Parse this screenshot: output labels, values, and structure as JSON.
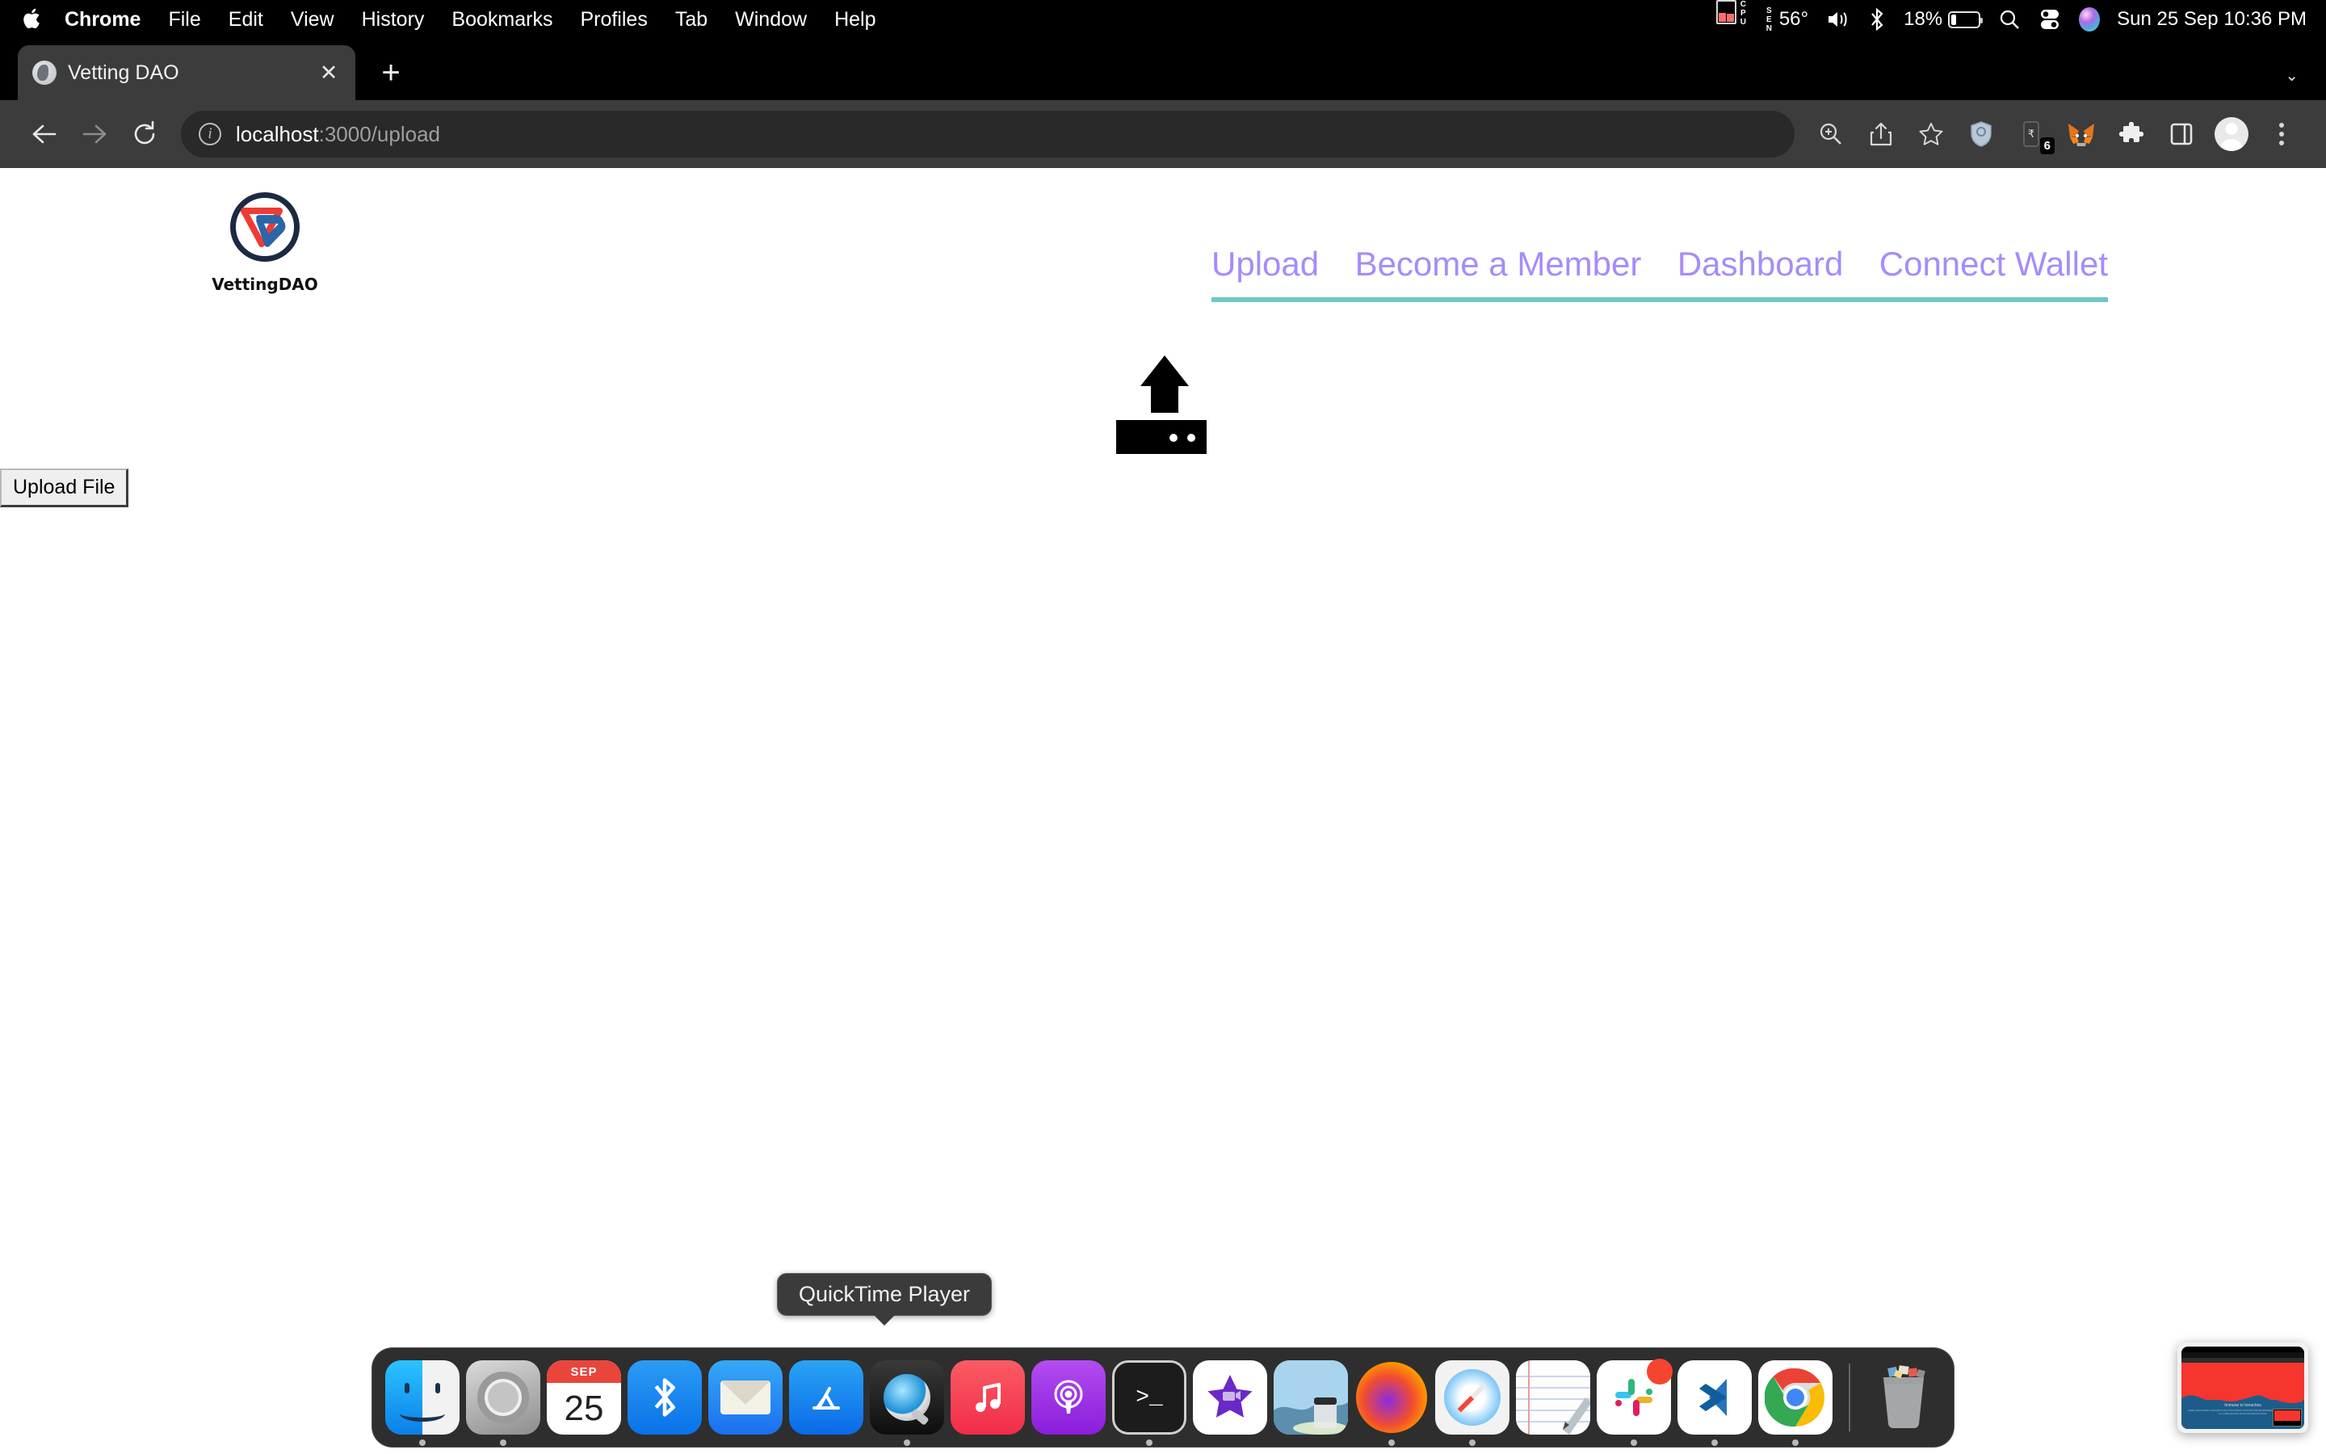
{
  "menubar": {
    "apple_icon": "apple-logo-icon",
    "items": [
      {
        "label": "Chrome",
        "bold": true
      },
      {
        "label": "File",
        "bold": false
      },
      {
        "label": "Edit",
        "bold": false
      },
      {
        "label": "View",
        "bold": false
      },
      {
        "label": "History",
        "bold": false
      },
      {
        "label": "Bookmarks",
        "bold": false
      },
      {
        "label": "Profiles",
        "bold": false
      },
      {
        "label": "Tab",
        "bold": false
      },
      {
        "label": "Window",
        "bold": false
      },
      {
        "label": "Help",
        "bold": false
      }
    ],
    "status": {
      "cpu_label": "CPU",
      "sensor_label": "SEN",
      "temperature": "56°",
      "volume_icon": "speaker-icon",
      "bluetooth_icon": "bluetooth-icon",
      "battery_percent": "18%",
      "battery_level": 18,
      "search_icon": "spotlight-search-icon",
      "control_center_icon": "control-center-icon",
      "siri_icon": "siri-icon",
      "clock": "Sun 25 Sep  10:36 PM"
    }
  },
  "browser": {
    "tab": {
      "title": "Vetting DAO",
      "favicon": "globe-favicon",
      "close_label": "✕"
    },
    "new_tab_label": "+",
    "tabstrip_chevron": "⌄",
    "toolbar": {
      "back_label": "←",
      "forward_label": "→",
      "reload_label": "⟳",
      "url_host": "localhost",
      "url_path": ":3000/upload",
      "site_info_label": "i",
      "icons": [
        {
          "name": "zoom-icon"
        },
        {
          "name": "share-icon"
        },
        {
          "name": "bookmark-star-icon"
        },
        {
          "name": "shield-extension-icon"
        },
        {
          "name": "wallet-extension-icon",
          "badge": "6"
        },
        {
          "name": "metamask-extension-icon"
        },
        {
          "name": "extensions-puzzle-icon"
        },
        {
          "name": "side-panel-icon"
        },
        {
          "name": "profile-avatar-icon"
        },
        {
          "name": "chrome-menu-icon"
        }
      ]
    }
  },
  "page": {
    "brand": {
      "logo_icon": "vettingdao-logo-icon",
      "name": "VettingDAO"
    },
    "nav": {
      "links": [
        {
          "label": "Upload"
        },
        {
          "label": "Become a Member"
        },
        {
          "label": "Dashboard"
        },
        {
          "label": "Connect Wallet"
        }
      ],
      "link_color": "#a78bfa",
      "underline_color": "#6ec6c6"
    },
    "upload": {
      "icon_name": "upload-arrow-icon",
      "button_label": "Upload File"
    },
    "background_color": "#ffffff"
  },
  "dock": {
    "tooltip": "QuickTime Player",
    "items": [
      {
        "name": "finder",
        "label": "Finder",
        "running": true
      },
      {
        "name": "system-settings",
        "label": "System Settings",
        "running": true
      },
      {
        "name": "calendar",
        "label": "Calendar",
        "running": false,
        "month": "SEP",
        "day": "25"
      },
      {
        "name": "bluetooth",
        "label": "Bluetooth",
        "running": false
      },
      {
        "name": "mail",
        "label": "Mail",
        "running": false
      },
      {
        "name": "app-store",
        "label": "App Store",
        "running": false
      },
      {
        "name": "quicktime-player",
        "label": "QuickTime Player",
        "running": true
      },
      {
        "name": "music",
        "label": "Music",
        "running": false
      },
      {
        "name": "podcasts",
        "label": "Podcasts",
        "running": false
      },
      {
        "name": "terminal",
        "label": "Terminal",
        "running": true
      },
      {
        "name": "imovie",
        "label": "iMovie",
        "running": false
      },
      {
        "name": "preview",
        "label": "Preview",
        "running": false
      },
      {
        "name": "firefox",
        "label": "Firefox",
        "running": true
      },
      {
        "name": "safari",
        "label": "Safari",
        "running": true
      },
      {
        "name": "notes",
        "label": "Notes",
        "running": false
      },
      {
        "name": "slack",
        "label": "Slack",
        "running": true,
        "badge": ""
      },
      {
        "name": "vscode",
        "label": "Visual Studio Code",
        "running": true
      },
      {
        "name": "chrome",
        "label": "Google Chrome",
        "running": true
      },
      {
        "name": "trash",
        "label": "Trash",
        "running": false
      }
    ]
  },
  "recording_thumbnail": {
    "name": "screen-recording-preview",
    "page_title": "Immune to breaches",
    "page_subtitle": "MADE USING SMART CONTRACTS FACTSTATIONDAO INVOLVES PRE-DETERMINED SMART CONTRACTS TO LAY SOME GROUND RULES AND REGULATIONS.",
    "accent_red": "#f5352e",
    "accent_blue": "#1d5c8a"
  }
}
